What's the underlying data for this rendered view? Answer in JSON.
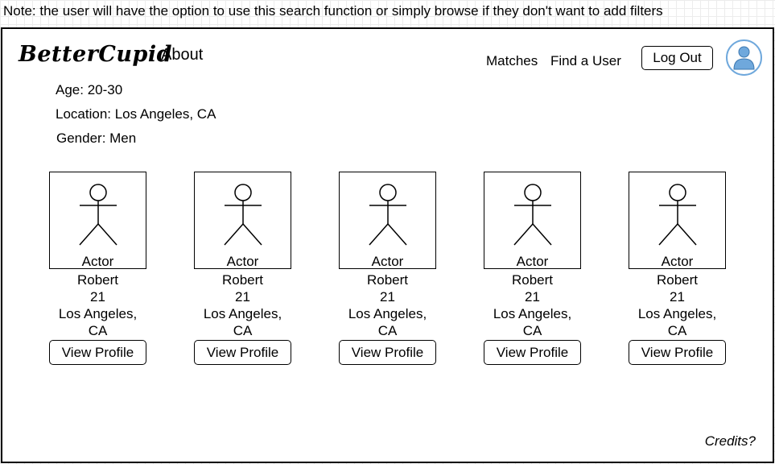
{
  "note": "Note: the user will have the option to use this search function or simply browse if they don't want to add filters",
  "header": {
    "logo": "BetterCupid",
    "about": "About",
    "nav": {
      "matches": "Matches",
      "find_user": "Find a User"
    },
    "logout": "Log Out",
    "avatar_icon": "user-avatar-icon",
    "avatar_color": "#6fa8dc"
  },
  "filters": {
    "age": "Age: 20-30",
    "location": "Location: Los Angeles, CA",
    "gender": "Gender: Men"
  },
  "cards": [
    {
      "role": "Actor",
      "name": "Robert",
      "age": "21",
      "city": "Los Angeles,",
      "state": "CA",
      "button": "View Profile"
    },
    {
      "role": "Actor",
      "name": "Robert",
      "age": "21",
      "city": "Los Angeles,",
      "state": "CA",
      "button": "View Profile"
    },
    {
      "role": "Actor",
      "name": "Robert",
      "age": "21",
      "city": "Los Angeles,",
      "state": "CA",
      "button": "View Profile"
    },
    {
      "role": "Actor",
      "name": "Robert",
      "age": "21",
      "city": "Los Angeles,",
      "state": "CA",
      "button": "View Profile"
    },
    {
      "role": "Actor",
      "name": "Robert",
      "age": "21",
      "city": "Los Angeles,",
      "state": "CA",
      "button": "View Profile"
    }
  ],
  "footer": {
    "credits": "Credits?"
  }
}
